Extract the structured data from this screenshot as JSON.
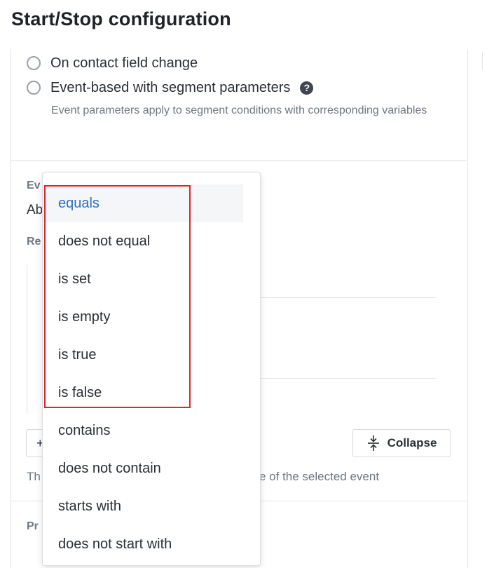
{
  "page": {
    "title": "Start/Stop configuration"
  },
  "start_options": [
    {
      "label": "On contact field change",
      "selected": false
    },
    {
      "label": "Event-based with segment parameters",
      "selected": false
    }
  ],
  "hint": "Event parameters apply to segment conditions with corresponding variables",
  "background": {
    "event_label_partial": "Ev",
    "event_value_partial": "Ab",
    "rules_label_partial": "Re",
    "footer_text_start": "Th",
    "footer_text_end": "e of the selected event",
    "properties_label_partial": "Pr",
    "add_button_partial": "+"
  },
  "collapse_button": {
    "label": "Collapse",
    "icon": "collapse-vertical-icon"
  },
  "operator_dropdown": {
    "selected": "equals",
    "options": [
      "equals",
      "does not equal",
      "is set",
      "is empty",
      "is true",
      "is false",
      "contains",
      "does not contain",
      "starts with",
      "does not start with"
    ]
  },
  "colors": {
    "selected_text": "#2f6fc1",
    "highlight_border": "#e0242b",
    "help_icon": "#3f4650"
  }
}
